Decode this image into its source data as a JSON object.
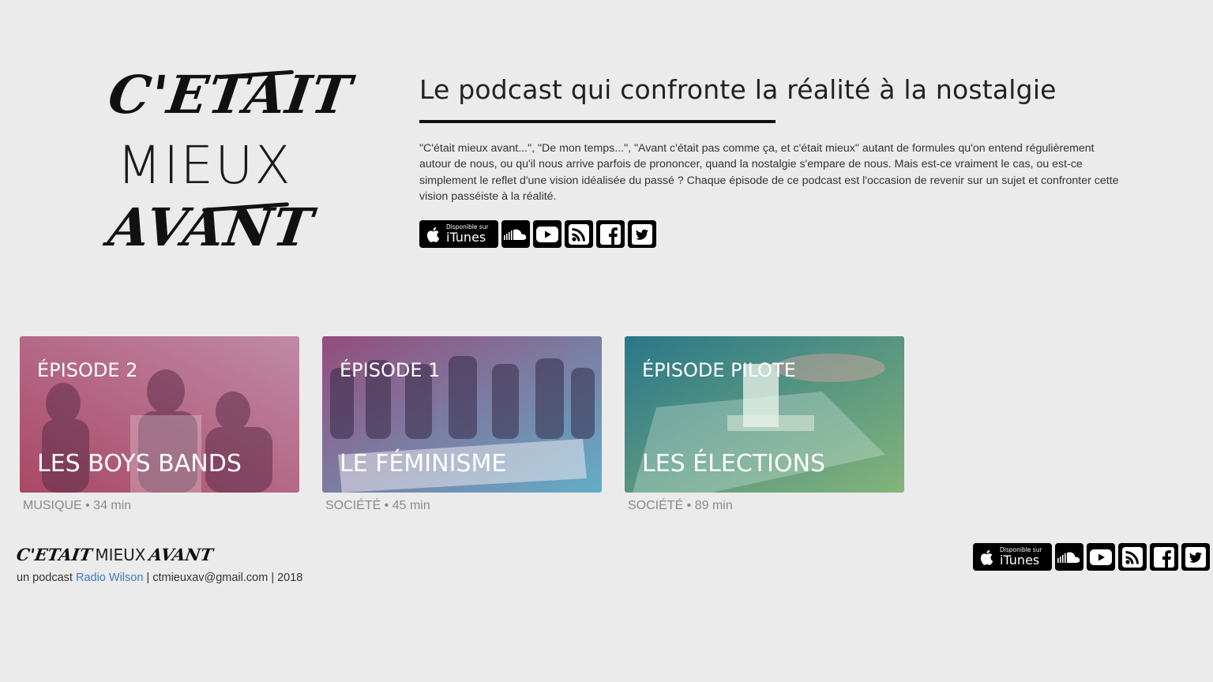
{
  "logo": {
    "line1": "C'ETAIT",
    "line2": "MIEUX",
    "line3": "AVANT"
  },
  "intro": {
    "title": "Le podcast qui confronte la réalité à la nostalgie",
    "description": "\"C'était mieux avant...\", \"De mon temps...\", \"Avant c'était pas comme ça, et c'était mieux\" autant de formules qu'on entend régulièrement autour de nous, ou qu'il nous arrive parfois de prononcer, quand la nostalgie s'empare de nous. Mais est-ce vraiment le cas, ou est-ce simplement le reflet d'une vision idéalisée du passé ? Chaque épisode de ce podcast est l'occasion de revenir sur un sujet et confronter cette vision passéiste à la réalité."
  },
  "social": {
    "itunes_small": "Disponible sur",
    "itunes_big": "iTunes",
    "icons": [
      "apple-icon",
      "soundcloud-icon",
      "youtube-icon",
      "rss-icon",
      "facebook-icon",
      "twitter-icon"
    ]
  },
  "episodes": [
    {
      "label": "ÉPISODE 2",
      "title": "LES BOYS BANDS",
      "meta": "MUSIQUE • 34 min",
      "colors": [
        "#b0506e",
        "#b97a9a"
      ]
    },
    {
      "label": "ÉPISODE 1",
      "title": "LE FÉMINISME",
      "meta": "SOCIÉTÉ • 45 min",
      "colors": [
        "#9a4f7e",
        "#6aa8c4"
      ]
    },
    {
      "label": "ÉPISODE PILOTE",
      "title": "LES ÉLECTIONS",
      "meta": "SOCIÉTÉ • 89 min",
      "colors": [
        "#2f7e8a",
        "#7fb07a"
      ]
    }
  ],
  "footer": {
    "logo_b1": "C'ETAIT",
    "logo_t": "MIEUX",
    "logo_b2": "AVANT",
    "prefix": "un podcast",
    "link": "Radio Wilson",
    "suffix": "| ctmieuxav@gmail.com | 2018"
  }
}
